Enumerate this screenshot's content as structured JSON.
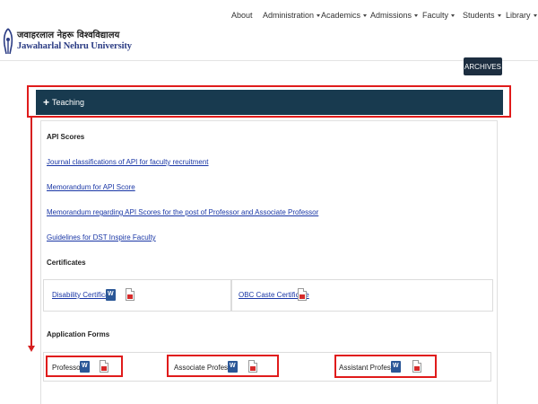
{
  "header": {
    "logo_hindi": "जवाहरलाल नेहरू विश्वविद्यालय",
    "logo_english": "Jawaharlal Nehru University"
  },
  "nav": {
    "items": [
      {
        "label": "About",
        "dropdown": false
      },
      {
        "label": "Administration",
        "dropdown": true
      },
      {
        "label": "Academics",
        "dropdown": true
      },
      {
        "label": "Admissions",
        "dropdown": true
      },
      {
        "label": "Faculty",
        "dropdown": true
      },
      {
        "label": "Students",
        "dropdown": true
      },
      {
        "label": "Library",
        "dropdown": true
      }
    ]
  },
  "archives_label": "ARCHIVES",
  "teaching": {
    "expand_symbol": "+",
    "label": "Teaching"
  },
  "api_scores": {
    "title": "API Scores",
    "links": [
      "Journal classifications of API for faculty recruitment",
      "Memorandum for API Score",
      "Memorandum regarding API Scores for the post of Professor and Associate Professor",
      "Guidelines for DST Inspire Faculty"
    ]
  },
  "certificates": {
    "title": "Certificates",
    "items": [
      {
        "label": "Disability Certificate",
        "icons": [
          "word-icon",
          "pdf-icon"
        ]
      },
      {
        "label": "OBC Caste Certificate",
        "icons": [
          "pdf-icon"
        ]
      }
    ]
  },
  "application_forms": {
    "title": "Application Forms",
    "items": [
      {
        "label": "Professor",
        "icons": [
          "word-icon",
          "pdf-icon"
        ]
      },
      {
        "label": "Associate Professor",
        "icons": [
          "word-icon",
          "pdf-icon"
        ]
      },
      {
        "label": "Assistant Professor",
        "icons": [
          "word-icon",
          "pdf-icon"
        ]
      }
    ]
  },
  "colors": {
    "teaching_bar": "#183a4f",
    "highlight_red": "#e01b1b",
    "link_blue": "#1a37a6",
    "brand_blue": "#2b3c84"
  }
}
